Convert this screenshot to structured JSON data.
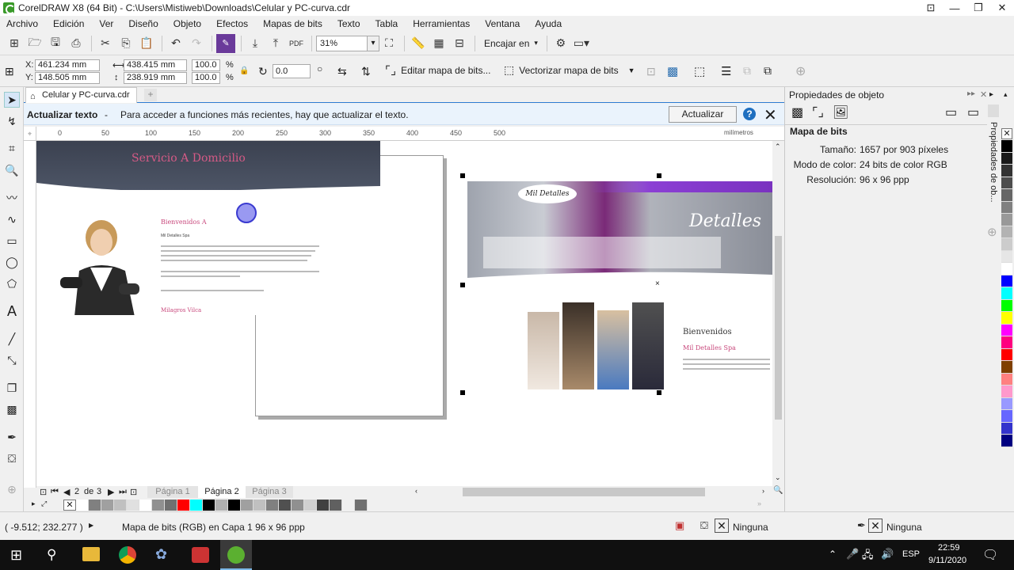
{
  "window": {
    "title": "CorelDRAW X8 (64 Bit) - C:\\Users\\Mistiweb\\Downloads\\Celular y PC-curva.cdr"
  },
  "menu": [
    "Archivo",
    "Edición",
    "Ver",
    "Diseño",
    "Objeto",
    "Efectos",
    "Mapas de bits",
    "Texto",
    "Tabla",
    "Herramientas",
    "Ventana",
    "Ayuda"
  ],
  "toolbar": {
    "zoom": "31%",
    "fit_label": "Encajar en"
  },
  "propbar": {
    "x_label": "X:",
    "y_label": "Y:",
    "x_value": "461.234 mm",
    "y_value": "148.505 mm",
    "w_value": "438.415 mm",
    "h_value": "238.919 mm",
    "sx_value": "100.0",
    "sy_value": "100.0",
    "pct": "%",
    "rotation": "0.0",
    "edit_bitmap": "Editar mapa de bits...",
    "trace_bitmap": "Vectorizar mapa de bits"
  },
  "document": {
    "tab": "Celular y PC-curva.cdr"
  },
  "infobar": {
    "title": "Actualizar texto",
    "dash": "-",
    "message": "Para acceder a funciones más recientes, hay que actualizar el texto.",
    "button": "Actualizar"
  },
  "ruler": {
    "ticks": [
      "0",
      "50",
      "100",
      "150",
      "200",
      "250",
      "300",
      "350",
      "400",
      "450",
      "500"
    ],
    "unit": "milímetros"
  },
  "artwork": {
    "banner_title": "Servicio A Domicilio",
    "welcome": "Bienvenidos A",
    "brand_small": "Mil Detalles Spa",
    "signature": "Milagros Vilca",
    "welcome2": "Bienvenidos",
    "brand2": "Mil Detalles Spa",
    "logo_text": "Mil Detalles",
    "salon_sign": "Detalles"
  },
  "pagenav": {
    "current": "2",
    "of": "de",
    "total": "3",
    "pages": [
      "Página 1",
      "Página 2",
      "Página 3"
    ]
  },
  "objprops": {
    "title": "Propiedades de objeto",
    "section": "Mapa de bits",
    "rows": [
      {
        "label": "Tamaño:",
        "value": "1657 por 903 píxeles"
      },
      {
        "label": "Modo de color:",
        "value": "24 bits de color RGB"
      },
      {
        "label": "Resolución:",
        "value": "96 x 96 ppp"
      }
    ],
    "vertical_tab": "Propiedades de ob..."
  },
  "status": {
    "coords": "( -9.512; 232.277 )",
    "arrow": "▶",
    "description": "Mapa de bits (RGB) en Capa 1 96 x 96 ppp",
    "fill": "Ninguna",
    "outline": "Ninguna"
  },
  "taskbar": {
    "lang": "ESP",
    "time": "22:59",
    "date": "9/11/2020"
  },
  "palette_colors": [
    "#000000",
    "#1a1a1a",
    "#333333",
    "#4d4d4d",
    "#666666",
    "#808080",
    "#999999",
    "#b3b3b3",
    "#cccccc",
    "#e6e6e6",
    "#ffffff",
    "#0000ff",
    "#00ffff",
    "#00ff00",
    "#ffff00",
    "#ff00ff",
    "#ff0080",
    "#ff0000",
    "#7f3f00",
    "#ff8080",
    "#ff99cc",
    "#9999ff",
    "#6666ff",
    "#3333cc",
    "#000080"
  ],
  "bottom_palette": [
    "#ffffff",
    "#808080",
    "#a0a0a0",
    "#c0c0c0",
    "#e0e0e0",
    "#ffffff",
    "#909090",
    "#707070",
    "#ff0000",
    "#00ffff",
    "#000000",
    "#b0b0b0",
    "#000000",
    "#a0a0a0",
    "#c0c0c0",
    "#808080",
    "#505050",
    "#909090",
    "#d0d0d0",
    "#404040",
    "#606060",
    "#f0f0f0",
    "#707070"
  ]
}
